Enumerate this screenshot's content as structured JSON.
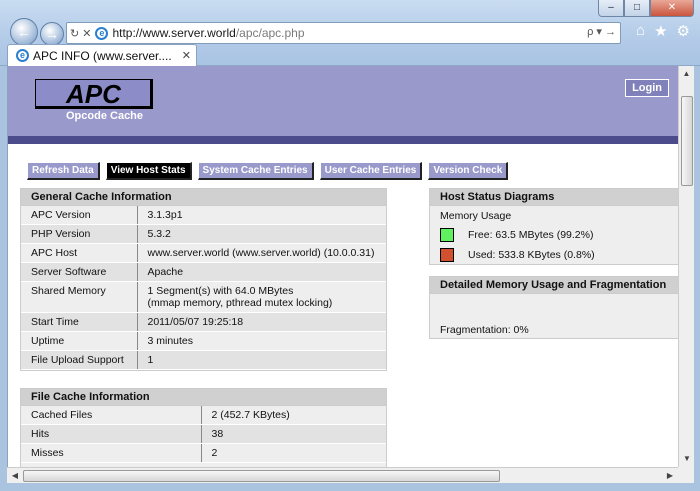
{
  "browser": {
    "url_prefix": "http://www.server.world",
    "url_path": "/apc/apc.php",
    "addr_controls": "ρ ▾ →",
    "tab_title": "APC INFO (www.server....",
    "tab_close": "✕",
    "minimize": "‒",
    "maximize": "□",
    "close": "✕"
  },
  "header": {
    "logo": "APC",
    "subtitle": "Opcode Cache",
    "login": "Login"
  },
  "menu": [
    {
      "label": "Refresh Data"
    },
    {
      "label": "View Host Stats",
      "active": true
    },
    {
      "label": "System Cache Entries"
    },
    {
      "label": "User Cache Entries"
    },
    {
      "label": "Version Check"
    }
  ],
  "general": {
    "title": "General Cache Information",
    "rows": [
      {
        "key": "APC Version",
        "value": "3.1.3p1"
      },
      {
        "key": "PHP Version",
        "value": "5.3.2"
      },
      {
        "key": "APC Host",
        "value": "www.server.world (www.server.world) (10.0.0.31)"
      },
      {
        "key": "Server Software",
        "value": "Apache"
      },
      {
        "key": "Shared Memory",
        "value": "1 Segment(s) with 64.0 MBytes",
        "value2": "(mmap memory, pthread mutex locking)"
      },
      {
        "key": "Start Time",
        "value": "2011/05/07 19:25:18"
      },
      {
        "key": "Uptime",
        "value": "3 minutes"
      },
      {
        "key": "File Upload Support",
        "value": "1"
      }
    ]
  },
  "file_cache": {
    "title": "File Cache Information",
    "rows": [
      {
        "key": "Cached Files",
        "value": "2 (452.7 KBytes)"
      },
      {
        "key": "Hits",
        "value": "38"
      },
      {
        "key": "Misses",
        "value": "2"
      }
    ]
  },
  "host_status": {
    "title": "Host Status Diagrams",
    "subtitle": "Memory Usage",
    "free_label": "Free: 63.5 MBytes (99.2%)",
    "used_label": "Used: 533.8 KBytes (0.8%)",
    "free_color": "#60f060",
    "used_color": "#d05030"
  },
  "memory": {
    "title": "Detailed Memory Usage and Fragmentation",
    "fragmentation": "Fragmentation: 0%"
  }
}
